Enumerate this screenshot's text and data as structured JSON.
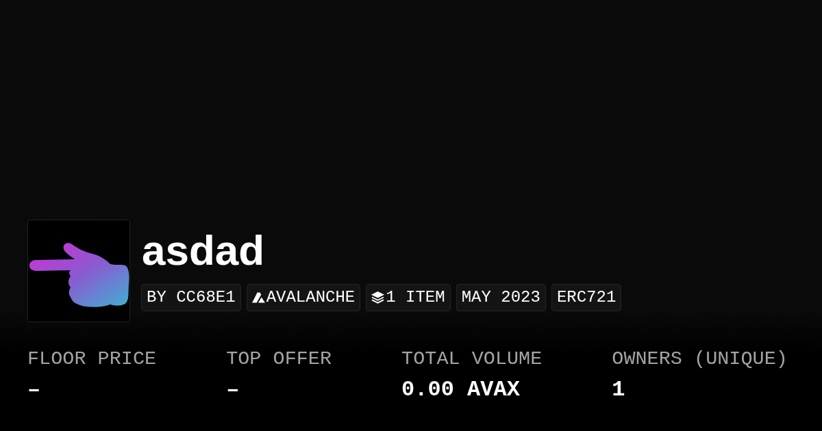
{
  "collection": {
    "name": "asdad",
    "tags": [
      {
        "kind": "creator",
        "label": "BY CC68E1"
      },
      {
        "kind": "chain",
        "label": "AVALANCHE"
      },
      {
        "kind": "items",
        "label": "1 ITEM"
      },
      {
        "kind": "date",
        "label": "MAY 2023"
      },
      {
        "kind": "standard",
        "label": "ERC721"
      }
    ]
  },
  "stats": [
    {
      "label": "FLOOR PRICE",
      "value": "–"
    },
    {
      "label": "TOP OFFER",
      "value": "–"
    },
    {
      "label": "TOTAL VOLUME",
      "value": "0.00 AVAX"
    },
    {
      "label": "OWNERS (UNIQUE)",
      "value": "1"
    }
  ]
}
